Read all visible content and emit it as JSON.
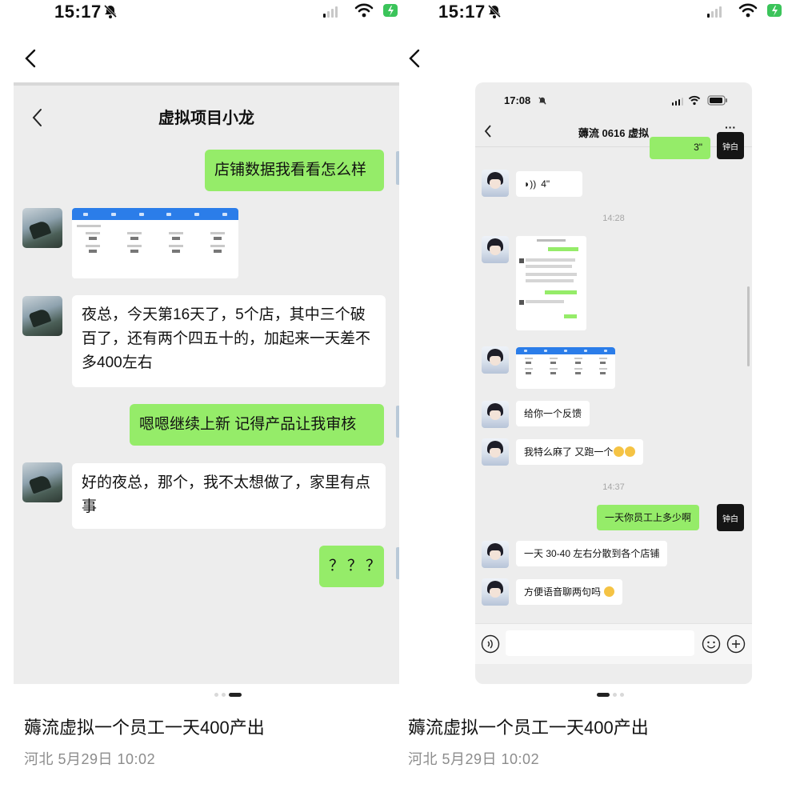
{
  "left": {
    "status": {
      "time": "15:17"
    },
    "chat": {
      "title": "虚拟项目小龙",
      "messages": [
        {
          "text": "店铺数据我看看怎么样"
        },
        {
          "text": "夜总，今天第16天了，5个店，其中三个破百了，还有两个四五十的，加起来一天差不多400左右"
        },
        {
          "text": "嗯嗯继续上新  记得产品让我审核"
        },
        {
          "text": "好的夜总，那个，我不太想做了，家里有点事"
        },
        {
          "text": "？？？"
        }
      ]
    },
    "caption": "薅流虚拟一个员工一天400产出",
    "meta": "河北  5月29日 10:02"
  },
  "right": {
    "status": {
      "time": "15:17"
    },
    "chat": {
      "status_time": "17:08",
      "title": "薅流 0616 虚拟",
      "more": "···",
      "top_voice": "3\"",
      "voice": "4\"",
      "time1": "14:28",
      "msg_feedback": "给你一个反馈",
      "msg_again": "我特么麻了 又跑一个",
      "time2": "14:37",
      "msg_question": "一天你员工上多少啊",
      "msg_answer": "一天 30-40 左右分散到各个店铺",
      "msg_voice": "方便语音聊两句吗",
      "dark_avatar_text": "钟白"
    },
    "caption": "薅流虚拟一个员工一天400产出",
    "meta": "河北  5月29日 10:02"
  },
  "colors": {
    "green_bubble": "#95ec69",
    "chat_bg": "#ededed",
    "header_blue": "#2b7de9"
  }
}
